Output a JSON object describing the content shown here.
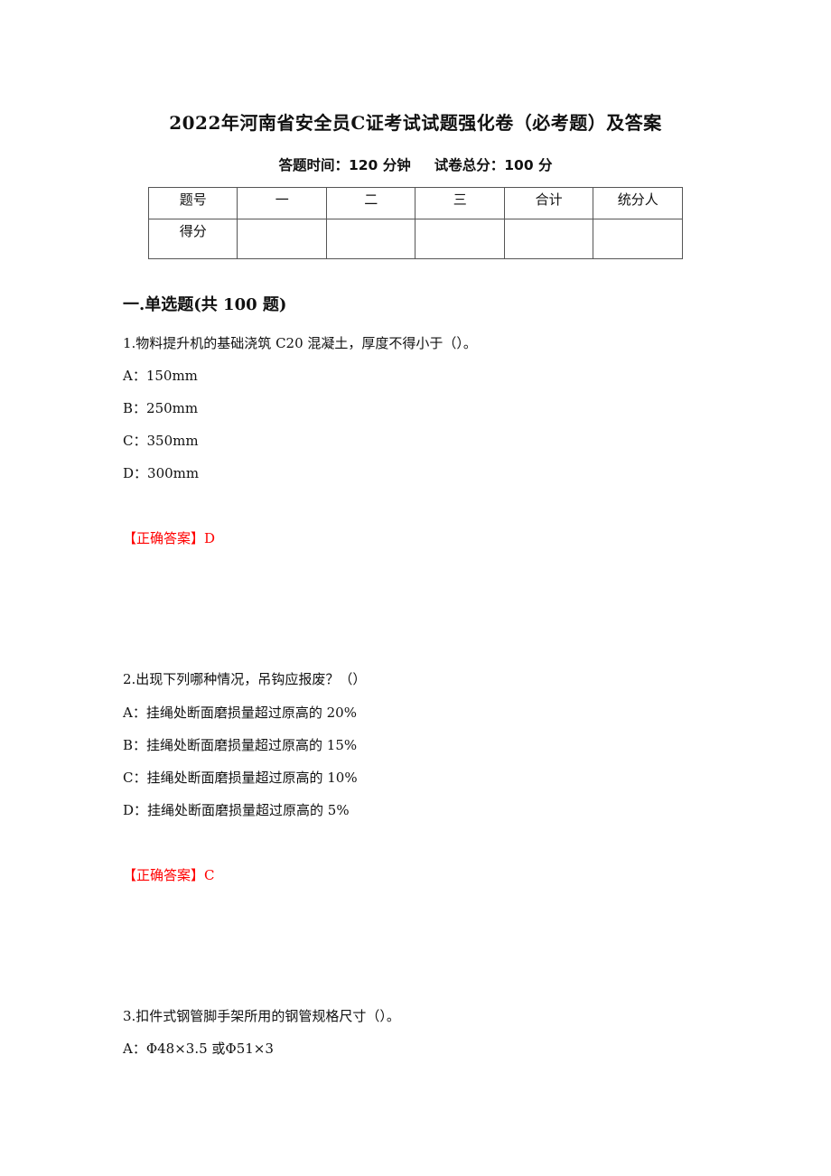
{
  "document": {
    "title": "2022年河南省安全员C证考试试题强化卷（必考题）及答案",
    "meta": {
      "time_label": "答题时间：120 分钟",
      "score_label": "试卷总分：100 分"
    },
    "score_table": {
      "header": [
        "题号",
        "一",
        "二",
        "三",
        "合计",
        "统分人"
      ],
      "row": [
        "得分",
        "",
        "",
        "",
        "",
        ""
      ]
    },
    "section_title": "一.单选题(共 100 题)",
    "questions": [
      {
        "stem": "1.物料提升机的基础浇筑 C20 混凝土，厚度不得小于（）。",
        "options": [
          "A：150mm",
          "B：250mm",
          "C：350mm",
          "D：300mm"
        ],
        "answer": "【正确答案】D"
      },
      {
        "stem": "2.出现下列哪种情况，吊钩应报废？（）",
        "options": [
          "A：挂绳处断面磨损量超过原高的 20%",
          "B：挂绳处断面磨损量超过原高的 15%",
          "C：挂绳处断面磨损量超过原高的 10%",
          "D：挂绳处断面磨损量超过原高的 5%"
        ],
        "answer": "【正确答案】C"
      },
      {
        "stem": "3.扣件式钢管脚手架所用的钢管规格尺寸（）。",
        "options": [
          "A：Φ48×3.5 或Φ51×3"
        ]
      }
    ],
    "colors": {
      "answer": "#ff0000",
      "text": "#111111"
    }
  }
}
